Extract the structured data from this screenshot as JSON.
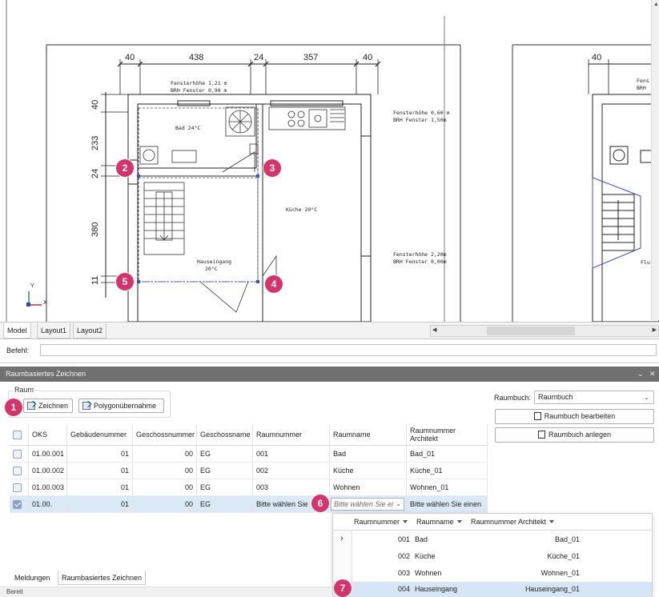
{
  "cad": {
    "dims_top": [
      "40",
      "438",
      "24",
      "357",
      "40"
    ],
    "dims_top_right": "40",
    "dims_left": [
      "40",
      "233",
      "24",
      "380",
      "11"
    ],
    "notes": {
      "window1_l1": "Fensterhöhe 1,21 m",
      "window1_l2": "BRH Fenster 0,90 m",
      "window2_l1": "Fensterhöhe 0,60 m",
      "window2_l2": "BRH Fenster 1,50m",
      "window3_l1": "Fensterhöhe 2,20m",
      "window3_l2": "BRH Fenster 0,00m",
      "right_note1": "Fens",
      "right_note2": "BRH"
    },
    "rooms": {
      "bad": "Bad 24°C",
      "kueche": "Küche 20°C",
      "hauseingang_l1": "Hauseingang",
      "hauseingang_l2": "20°C",
      "flur": "Flur"
    },
    "axis_y": "Y",
    "axis_x": "X",
    "badges": [
      "1",
      "2",
      "3",
      "4",
      "5",
      "6",
      "7"
    ]
  },
  "layout_tabs": [
    "Model",
    "Layout1",
    "Layout2"
  ],
  "command": {
    "label": "Befehl:"
  },
  "panel": {
    "title": "Raumbasiertes Zeichnen",
    "collapse_icon": "chevron-down-icon",
    "close_icon": "close-icon",
    "group_label": "Raum",
    "draw_button": "Zeichnen",
    "polygon_button": "Polygonübernahme",
    "raumbuch_label": "Raumbuch:",
    "raumbuch_value": "Raumbuch",
    "edit_button": "Raumbuch bearbeiten",
    "create_button": "Raumbuch anlegen"
  },
  "table": {
    "headers": [
      "OKS",
      "Gebäudenummer",
      "Geschossnummer",
      "Geschossname",
      "Raumnummer",
      "Raumname",
      "Raumnummer Architekt"
    ],
    "rows": [
      [
        "01.00.001",
        "01",
        "00",
        "EG",
        "001",
        "Bad",
        "Bad_01"
      ],
      [
        "01.00.002",
        "01",
        "00",
        "EG",
        "002",
        "Küche",
        "Küche_01"
      ],
      [
        "01.00.003",
        "01",
        "00",
        "EG",
        "003",
        "Wohnen",
        "Wohnen_01"
      ],
      [
        "01.00.",
        "01",
        "00",
        "EG",
        "Bitte wählen Sie",
        "Bitte wählen Sie ei",
        "Bitte wählen Sie einen"
      ]
    ]
  },
  "dropdown": {
    "headers": [
      "Raumnummer",
      "Raumname",
      "Raumnummer Architekt"
    ],
    "rows": [
      [
        "001",
        "Bad",
        "Bad_01"
      ],
      [
        "002",
        "Küche",
        "Küche_01"
      ],
      [
        "003",
        "Wohnen",
        "Wohnen_01"
      ],
      [
        "004",
        "Hauseingang",
        "Hauseingang_01"
      ]
    ],
    "expander": "›"
  },
  "bottom_tabs": [
    "Meldungen",
    "Raumbasiertes Zeichnen"
  ],
  "status": "Bereit",
  "colors": {
    "badge": "#d6336c",
    "selection": "#dbe9f7",
    "panel_title": "#707070",
    "polyline": "#3a4fd6"
  }
}
